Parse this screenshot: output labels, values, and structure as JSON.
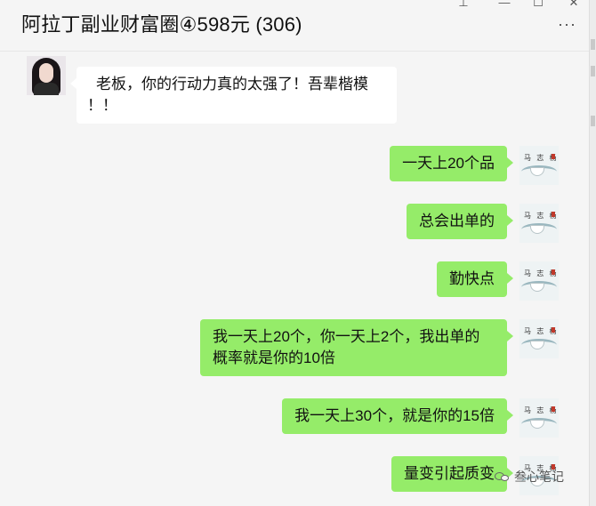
{
  "header": {
    "title": "阿拉丁副业财富圈④598元 (306)",
    "controls": {
      "pin_icon": "⊥",
      "minimize_icon": "—",
      "maximize_icon": "☐",
      "close_icon": "✕",
      "more_icon": "···"
    }
  },
  "messages": [
    {
      "side": "in",
      "lines": [
        "老板，你的行动力真的太强了！吾辈楷模",
        "！！"
      ]
    },
    {
      "side": "out",
      "lines": [
        "一天上20个品"
      ]
    },
    {
      "side": "out",
      "lines": [
        "总会出单的"
      ]
    },
    {
      "side": "out",
      "lines": [
        "勤快点"
      ]
    },
    {
      "side": "out",
      "lines": [
        "我一天上20个，你一天上2个，我出单的",
        "概率就是你的10倍"
      ]
    },
    {
      "side": "out",
      "lines": [
        "我一天上30个，就是你的15倍"
      ]
    },
    {
      "side": "out",
      "lines": [
        "量变引起质变"
      ]
    }
  ],
  "watermark": {
    "text": "叁心笔记"
  },
  "colors": {
    "self_bubble": "#95ec69",
    "other_bubble": "#ffffff",
    "background": "#f5f5f5"
  }
}
